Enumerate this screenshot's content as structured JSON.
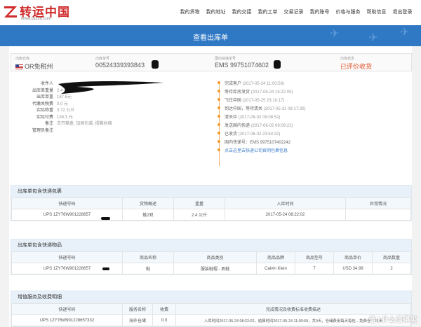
{
  "header": {
    "logo_text": "转运中国",
    "logo_url": "www.uszcn.com",
    "nav": [
      "我的货物",
      "我的地址",
      "我的交接",
      "我的工单",
      "交易记录",
      "我的账号",
      "价格与服务",
      "帮助信息",
      "退出登录"
    ]
  },
  "banner": {
    "title": "查看出库单"
  },
  "strip": {
    "warehouse": {
      "label": "出库仓库",
      "value": "OR免税州"
    },
    "order_no": {
      "label": "出库单号",
      "value": "00524339393843"
    },
    "domestic": {
      "label": "国内快递单号",
      "value": "EMS 99751074602"
    },
    "status": {
      "label": "出库状态",
      "value": "已评价收货"
    }
  },
  "details": [
    {
      "label": "收件人",
      "value": ""
    },
    {
      "label": "出库单重量",
      "value": "2.4 公斤"
    },
    {
      "label": "出库单重",
      "value": "187.6元"
    },
    {
      "label": "代缴关税费",
      "value": "0.0 元"
    },
    {
      "label": "实际称重",
      "value": "3.72 公斤"
    },
    {
      "label": "实际付费",
      "value": "138.3 元"
    },
    {
      "label": "备注",
      "value": "去开箱盒, 加固包装, 摆箱收缩"
    },
    {
      "label": "管理员备注",
      "value": ""
    }
  ],
  "timeline": [
    {
      "text": "完成客户",
      "time": "(2017-05-24 11:00:59)"
    },
    {
      "text": "等待库房发货",
      "time": "(2017-05-24 15:22:00)"
    },
    {
      "text": "飞往中国",
      "time": "(2017-05-25 23:10:17)"
    },
    {
      "text": "到达中国，等待清关",
      "time": "(2017-05-31 09:17:30)"
    },
    {
      "text": "清关中",
      "time": "(2017-06-02 09:08:52)"
    },
    {
      "text": "发送国内快递",
      "time": "(2017-06-02 09:09:22)"
    },
    {
      "text": "已收货",
      "time": "(2017-06-02 23:54:32)"
    },
    {
      "text": "国内快递号：EMS 9975107402242",
      "time": ""
    },
    {
      "text": "点击这里去快递公司官网包裹信息",
      "time": ""
    }
  ],
  "pkg_section": {
    "title": "出库单包含快递包裹",
    "headers": [
      "快递号码",
      "货物概述",
      "重量",
      "入库时间",
      "异常情况"
    ],
    "rows": [
      [
        "UPS 1ZY76W901228657",
        "鞋2双",
        "2.4 公斤",
        "2017-05-24 08:22:02",
        ""
      ]
    ]
  },
  "goods_section": {
    "title": "出库单包含快递物品",
    "headers": [
      "快递号码",
      "商品名称",
      "商品类别",
      "商品品牌",
      "商品型号",
      "商品单价",
      "商品数量"
    ],
    "rows": [
      [
        "UPS 1ZY76W901228657",
        "鞋",
        "服装鞋帽 - 男鞋",
        "Calvin Klein",
        "7",
        "USD 34.99",
        "2"
      ]
    ]
  },
  "fee_section": {
    "title": "增值服务及收费明细",
    "headers": [
      "快递号码",
      "服务名称",
      "收费",
      "完成情况及收费标准收费描述"
    ],
    "rows": [
      [
        "UPS 1ZY76W901228657332",
        "海外仓储",
        "0.0",
        "入库时间2017-05-24 08:22:02，结算时间2017-05-24 11:00:59，共0天，仓储费用每天每包…免费仓储21天"
      ]
    ]
  },
  "watermark": "值 | 什么值得买"
}
